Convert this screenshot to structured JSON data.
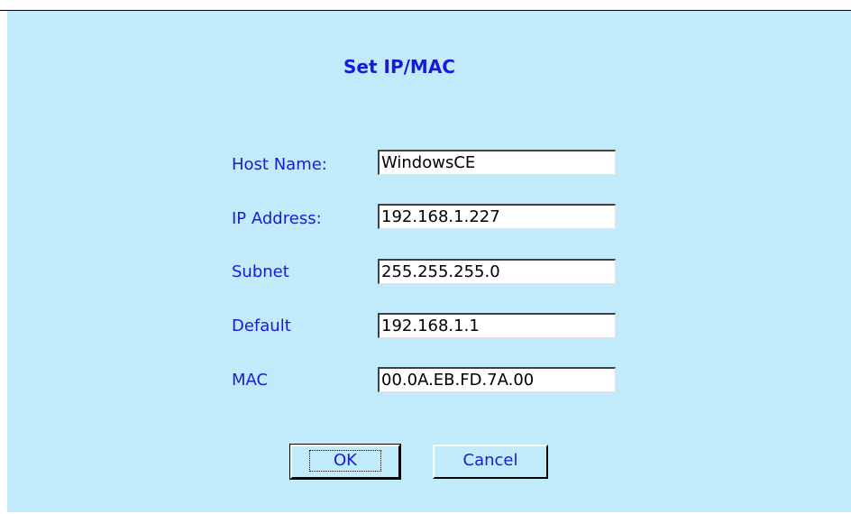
{
  "dialog": {
    "title": "Set IP/MAC",
    "fields": [
      {
        "label": "Host Name:",
        "value": "WindowsCE"
      },
      {
        "label": "IP Address:",
        "value": "192.168.1.227"
      },
      {
        "label": "Subnet",
        "value": "255.255.255.0"
      },
      {
        "label": "Default",
        "value": "192.168.1.1"
      },
      {
        "label": "MAC",
        "value": "00.0A.EB.FD.7A.00"
      }
    ],
    "buttons": {
      "ok": "OK",
      "cancel": "Cancel"
    }
  },
  "colors": {
    "background": "#c1ebfb",
    "label_text": "#1a1ad6"
  }
}
